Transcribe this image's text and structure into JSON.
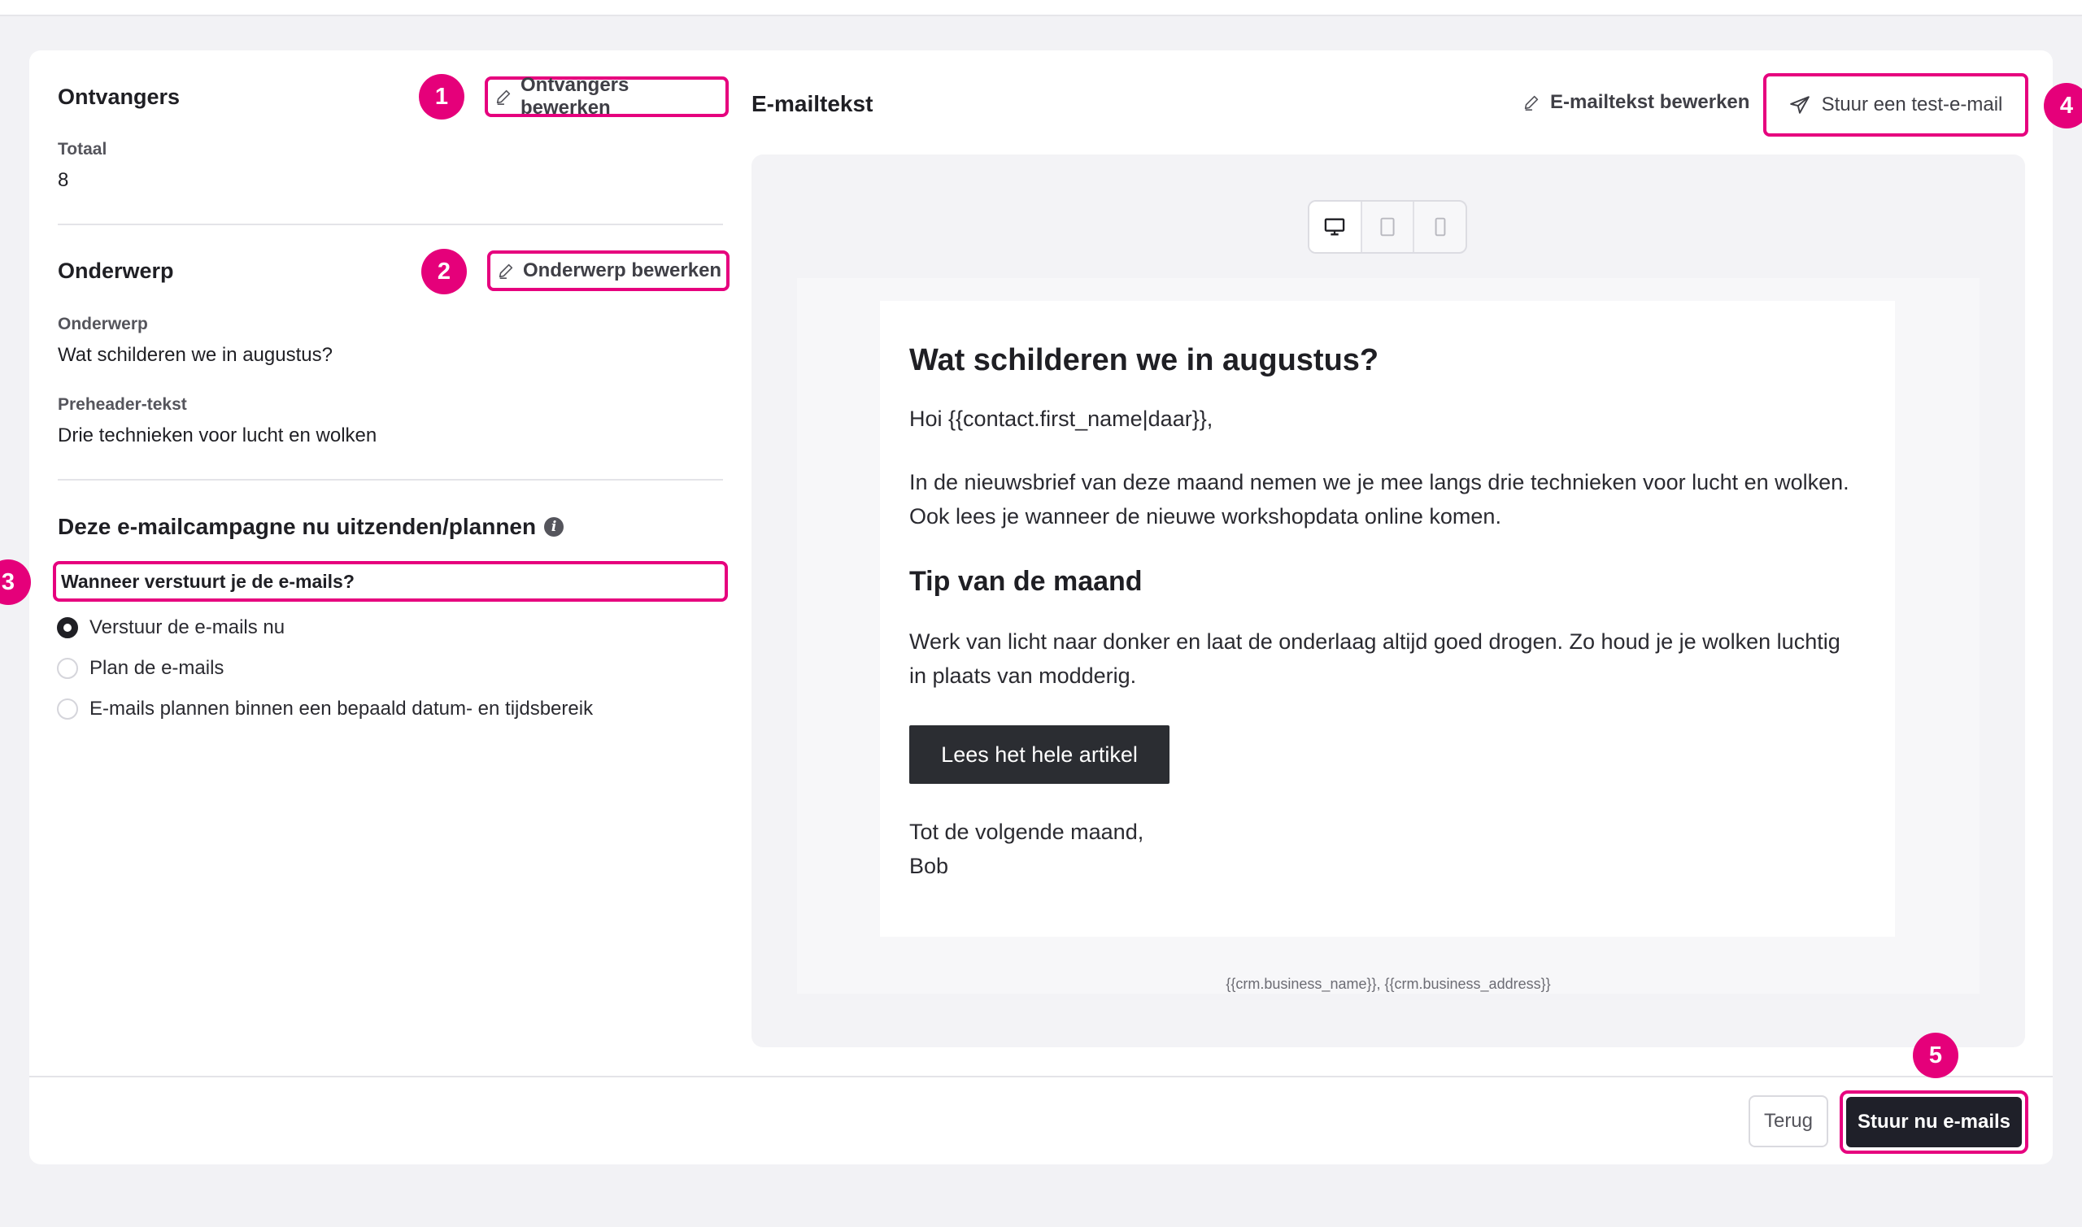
{
  "recipients": {
    "title": "Ontvangers",
    "edit_label": "Ontvangers bewerken",
    "total_label": "Totaal",
    "total_value": "8"
  },
  "subject": {
    "title": "Onderwerp",
    "edit_label": "Onderwerp bewerken",
    "subject_label": "Onderwerp",
    "subject_value": "Wat schilderen we in augustus?",
    "preheader_label": "Preheader-tekst",
    "preheader_value": "Drie technieken voor lucht en wolken"
  },
  "schedule": {
    "title": "Deze e-mailcampagne nu uitzenden/plannen",
    "info_icon": "i",
    "question": "Wanneer verstuurt je de e-mails?",
    "options": [
      {
        "label": "Verstuur de e-mails nu",
        "selected": true
      },
      {
        "label": "Plan de e-mails",
        "selected": false
      },
      {
        "label": "E-mails plannen binnen een bepaald datum- en tijdsbereik",
        "selected": false
      }
    ]
  },
  "email_body": {
    "title": "E-mailtekst",
    "edit_label": "E-mailtekst bewerken",
    "test_label": "Stuur een test-e-mail",
    "preview": {
      "heading": "Wat schilderen we in augustus?",
      "greeting": "Hoi {{contact.first_name|daar}},",
      "intro": "In de nieuwsbrief van deze maand nemen we je mee langs drie technieken voor lucht en wolken. Ook lees je wanneer de nieuwe workshopdata online komen.",
      "tip_heading": "Tip van de maand",
      "tip_text": "Werk van licht naar donker en laat de onderlaag altijd goed drogen. Zo houd je je wolken luchtig in plaats van modderig.",
      "cta_label": "Lees het hele artikel",
      "signoff_line1": "Tot de volgende maand,",
      "signoff_line2": "Bob",
      "footer_vars": "{{crm.business_name}}, {{crm.business_address}}"
    }
  },
  "footer": {
    "back_label": "Terug",
    "send_label": "Stuur nu e-mails"
  },
  "badges": [
    "1",
    "2",
    "3",
    "4",
    "5"
  ],
  "colors": {
    "highlight": "#e6007e",
    "badge": "#e5007a",
    "primary_button": "#1f2029",
    "email_cta": "#2b2d32"
  }
}
